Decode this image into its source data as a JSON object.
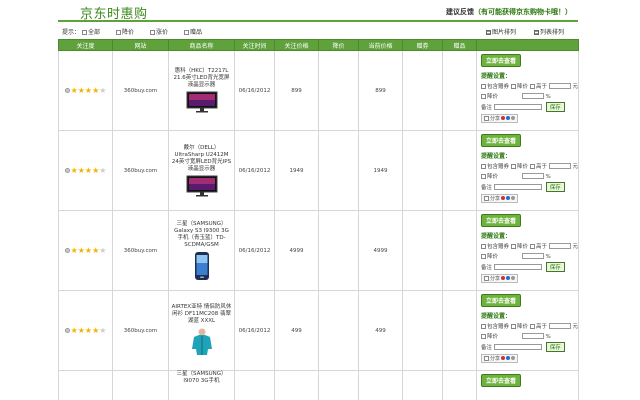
{
  "header": {
    "logo": "京东时惠购",
    "feedback_label": "建议反馈",
    "feedback_note": "（有可能获得京东购物卡哦！）"
  },
  "filter": {
    "label": "提示：",
    "options": [
      "全部",
      "降价",
      "涨价",
      "赠品"
    ],
    "view_grid": "图片排列",
    "view_list": "列表排列"
  },
  "table": {
    "columns": [
      "关注度",
      "网站",
      "商品名称",
      "关注时间",
      "关注价格",
      "降价",
      "当前价格",
      "赠券",
      "赠品",
      ""
    ]
  },
  "action_labels": {
    "go_button": "立即去查看",
    "settings_title": "提醒设置：",
    "include_coupon": "包含赠券",
    "price_drop": "降价",
    "price_rise": "涨价",
    "above": "高于",
    "unit": "元",
    "drop_by": "降价",
    "percent": "%",
    "remark": "备注",
    "save": "保存",
    "share": "分享"
  },
  "rows": [
    {
      "rating": 4,
      "site": "360buy.com",
      "name": "惠科（HKC）T2217L 21.6英寸LED背光宽屏液晶显示器",
      "date": "06/16/2012",
      "price": "899",
      "drop": "",
      "current": "899",
      "coupon": "",
      "gift": "",
      "thumb": "monitor"
    },
    {
      "rating": 4,
      "site": "360buy.com",
      "name": "戴尔（DELL）UltraSharp U2412M 24英寸宽屏LED背光IPS液晶显示器",
      "date": "06/16/2012",
      "price": "1949",
      "drop": "",
      "current": "1949",
      "coupon": "",
      "gift": "",
      "thumb": "monitor"
    },
    {
      "rating": 4,
      "site": "360buy.com",
      "name": "三星（SAMSUNG）Galaxy S3 I9300 3G手机（青玉蓝）TD-SCDMA/GSM",
      "date": "06/16/2012",
      "price": "4999",
      "drop": "",
      "current": "4999",
      "coupon": "",
      "gift": "",
      "thumb": "phone"
    },
    {
      "rating": 4,
      "site": "360buy.com",
      "name": "AIRTEX亚特 情侣防风休闲衫 DF11MC208 翡翠湖蓝 XXXL",
      "date": "06/16/2012",
      "price": "499",
      "drop": "",
      "current": "499",
      "coupon": "",
      "gift": "",
      "thumb": "jacket"
    },
    {
      "rating": 0,
      "site": "",
      "name": "三星（SAMSUNG）I9070 3G手机",
      "date": "",
      "price": "",
      "drop": "",
      "current": "",
      "coupon": "",
      "gift": "",
      "thumb": "none"
    }
  ],
  "colors": {
    "accent": "#5fa13a",
    "logo": "#3d8a1e"
  }
}
